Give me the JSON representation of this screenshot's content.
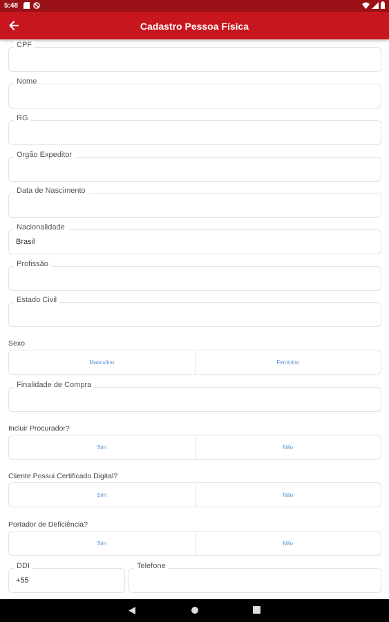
{
  "status_bar": {
    "time": "5:48"
  },
  "app_bar": {
    "title": "Cadastro Pessoa Física"
  },
  "form": {
    "cpf": {
      "label": "CPF",
      "value": ""
    },
    "nome": {
      "label": "Nome",
      "value": ""
    },
    "rg": {
      "label": "RG",
      "value": ""
    },
    "orgao_expeditor": {
      "label": "Orgão Expeditor",
      "value": ""
    },
    "data_nascimento": {
      "label": "Data de Nascimento",
      "value": ""
    },
    "nacionalidade": {
      "label": "Nacionalidade",
      "value": "Brasil"
    },
    "profissao": {
      "label": "Profissão",
      "value": ""
    },
    "estado_civil": {
      "label": "Estado Civil",
      "value": ""
    },
    "sexo": {
      "label": "Sexo",
      "options": [
        "Masculino",
        "Feminino"
      ]
    },
    "finalidade_compra": {
      "label": "Finalidade de Compra",
      "value": ""
    },
    "incluir_procurador": {
      "label": "Incluir Procurador?",
      "options": [
        "Sim",
        "Não"
      ]
    },
    "certificado_digital": {
      "label": "Cliente Possui Certificado Digital?",
      "options": [
        "Sim",
        "Não"
      ]
    },
    "portador_deficiencia": {
      "label": "Portador de Deficiência?",
      "options": [
        "Sim",
        "Não"
      ]
    },
    "ddi": {
      "label": "DDI",
      "value": "+55"
    },
    "telefone": {
      "label": "Telefone",
      "value": ""
    }
  },
  "colors": {
    "app_bar": "#c8161e",
    "status_bar": "#9b1118",
    "option_text": "#5a8fd8"
  }
}
